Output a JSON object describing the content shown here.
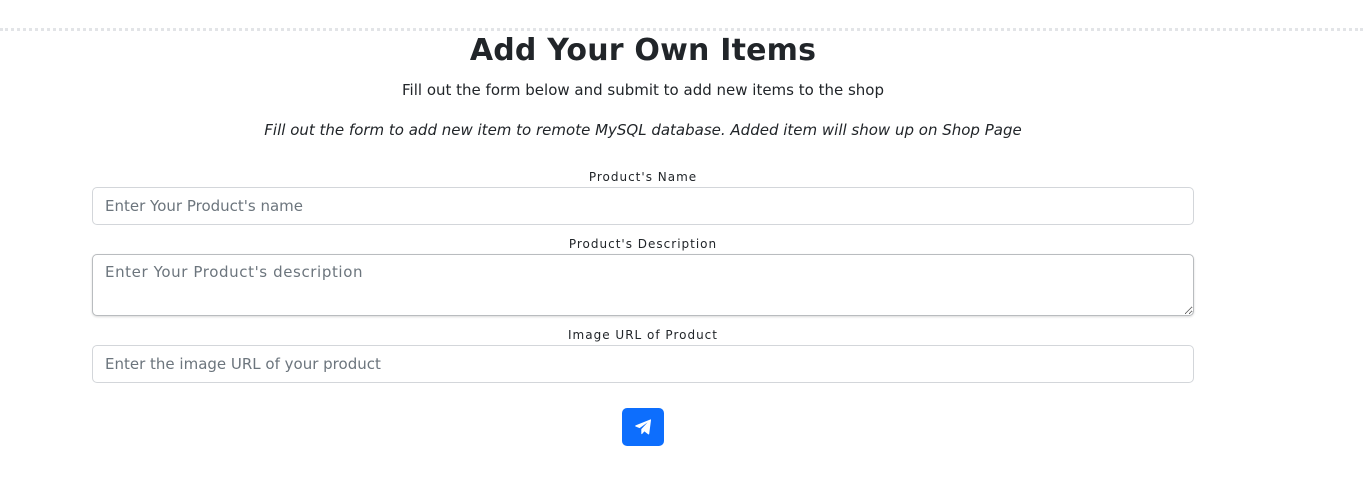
{
  "header": {
    "title": "Add Your Own Items",
    "subtitle": "Fill out the form below and submit to add new items to the shop",
    "note": "Fill out the form to add new item to remote MySQL database. Added item will show up on Shop Page"
  },
  "form": {
    "name": {
      "label": "Product's Name",
      "placeholder": "Enter Your Product's name",
      "value": ""
    },
    "description": {
      "label": "Product's Description",
      "placeholder": "Enter Your Product's description",
      "value": ""
    },
    "image_url": {
      "label": "Image URL of Product",
      "placeholder": "Enter the image URL of your product",
      "value": ""
    },
    "submit": {
      "icon": "paper-plane-icon",
      "aria_label": "Submit"
    }
  },
  "colors": {
    "accent": "#0d6efd",
    "text": "#212529",
    "placeholder": "#6c757d",
    "border": "#d3d6da"
  }
}
